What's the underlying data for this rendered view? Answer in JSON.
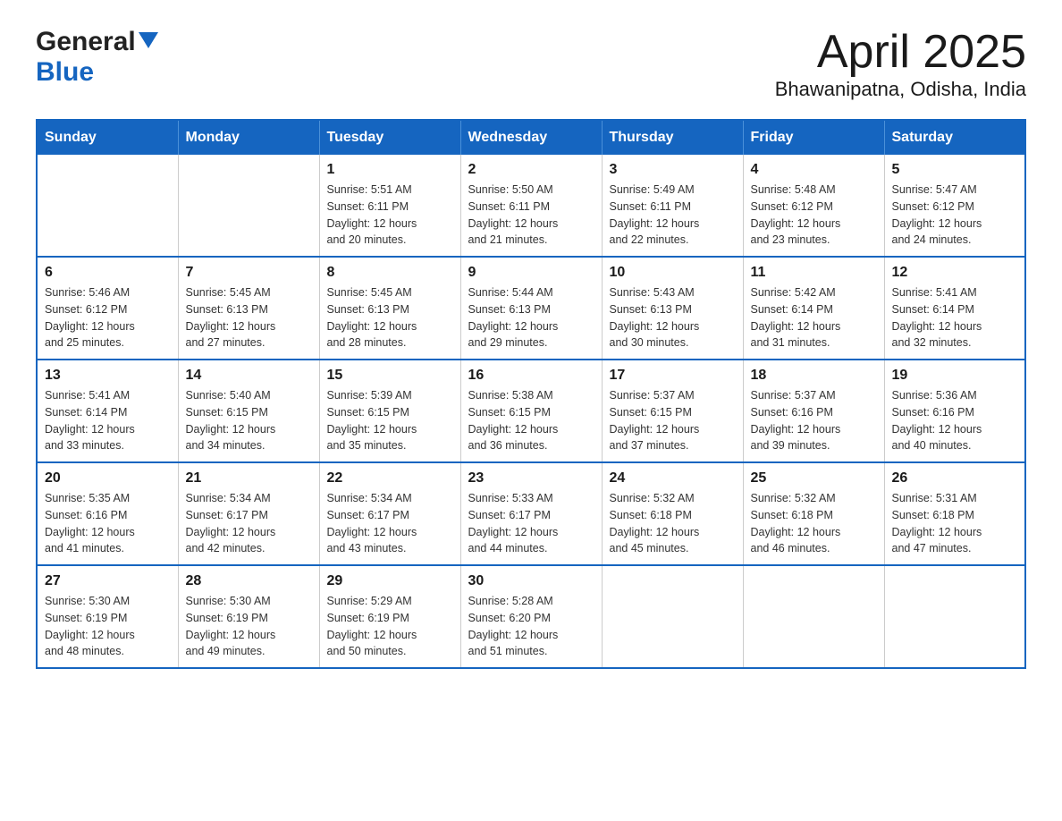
{
  "header": {
    "logo_general": "General",
    "logo_blue": "Blue",
    "month_year": "April 2025",
    "location": "Bhawanipatna, Odisha, India"
  },
  "days_of_week": [
    "Sunday",
    "Monday",
    "Tuesday",
    "Wednesday",
    "Thursday",
    "Friday",
    "Saturday"
  ],
  "weeks": [
    [
      {
        "day": "",
        "info": ""
      },
      {
        "day": "",
        "info": ""
      },
      {
        "day": "1",
        "info": "Sunrise: 5:51 AM\nSunset: 6:11 PM\nDaylight: 12 hours\nand 20 minutes."
      },
      {
        "day": "2",
        "info": "Sunrise: 5:50 AM\nSunset: 6:11 PM\nDaylight: 12 hours\nand 21 minutes."
      },
      {
        "day": "3",
        "info": "Sunrise: 5:49 AM\nSunset: 6:11 PM\nDaylight: 12 hours\nand 22 minutes."
      },
      {
        "day": "4",
        "info": "Sunrise: 5:48 AM\nSunset: 6:12 PM\nDaylight: 12 hours\nand 23 minutes."
      },
      {
        "day": "5",
        "info": "Sunrise: 5:47 AM\nSunset: 6:12 PM\nDaylight: 12 hours\nand 24 minutes."
      }
    ],
    [
      {
        "day": "6",
        "info": "Sunrise: 5:46 AM\nSunset: 6:12 PM\nDaylight: 12 hours\nand 25 minutes."
      },
      {
        "day": "7",
        "info": "Sunrise: 5:45 AM\nSunset: 6:13 PM\nDaylight: 12 hours\nand 27 minutes."
      },
      {
        "day": "8",
        "info": "Sunrise: 5:45 AM\nSunset: 6:13 PM\nDaylight: 12 hours\nand 28 minutes."
      },
      {
        "day": "9",
        "info": "Sunrise: 5:44 AM\nSunset: 6:13 PM\nDaylight: 12 hours\nand 29 minutes."
      },
      {
        "day": "10",
        "info": "Sunrise: 5:43 AM\nSunset: 6:13 PM\nDaylight: 12 hours\nand 30 minutes."
      },
      {
        "day": "11",
        "info": "Sunrise: 5:42 AM\nSunset: 6:14 PM\nDaylight: 12 hours\nand 31 minutes."
      },
      {
        "day": "12",
        "info": "Sunrise: 5:41 AM\nSunset: 6:14 PM\nDaylight: 12 hours\nand 32 minutes."
      }
    ],
    [
      {
        "day": "13",
        "info": "Sunrise: 5:41 AM\nSunset: 6:14 PM\nDaylight: 12 hours\nand 33 minutes."
      },
      {
        "day": "14",
        "info": "Sunrise: 5:40 AM\nSunset: 6:15 PM\nDaylight: 12 hours\nand 34 minutes."
      },
      {
        "day": "15",
        "info": "Sunrise: 5:39 AM\nSunset: 6:15 PM\nDaylight: 12 hours\nand 35 minutes."
      },
      {
        "day": "16",
        "info": "Sunrise: 5:38 AM\nSunset: 6:15 PM\nDaylight: 12 hours\nand 36 minutes."
      },
      {
        "day": "17",
        "info": "Sunrise: 5:37 AM\nSunset: 6:15 PM\nDaylight: 12 hours\nand 37 minutes."
      },
      {
        "day": "18",
        "info": "Sunrise: 5:37 AM\nSunset: 6:16 PM\nDaylight: 12 hours\nand 39 minutes."
      },
      {
        "day": "19",
        "info": "Sunrise: 5:36 AM\nSunset: 6:16 PM\nDaylight: 12 hours\nand 40 minutes."
      }
    ],
    [
      {
        "day": "20",
        "info": "Sunrise: 5:35 AM\nSunset: 6:16 PM\nDaylight: 12 hours\nand 41 minutes."
      },
      {
        "day": "21",
        "info": "Sunrise: 5:34 AM\nSunset: 6:17 PM\nDaylight: 12 hours\nand 42 minutes."
      },
      {
        "day": "22",
        "info": "Sunrise: 5:34 AM\nSunset: 6:17 PM\nDaylight: 12 hours\nand 43 minutes."
      },
      {
        "day": "23",
        "info": "Sunrise: 5:33 AM\nSunset: 6:17 PM\nDaylight: 12 hours\nand 44 minutes."
      },
      {
        "day": "24",
        "info": "Sunrise: 5:32 AM\nSunset: 6:18 PM\nDaylight: 12 hours\nand 45 minutes."
      },
      {
        "day": "25",
        "info": "Sunrise: 5:32 AM\nSunset: 6:18 PM\nDaylight: 12 hours\nand 46 minutes."
      },
      {
        "day": "26",
        "info": "Sunrise: 5:31 AM\nSunset: 6:18 PM\nDaylight: 12 hours\nand 47 minutes."
      }
    ],
    [
      {
        "day": "27",
        "info": "Sunrise: 5:30 AM\nSunset: 6:19 PM\nDaylight: 12 hours\nand 48 minutes."
      },
      {
        "day": "28",
        "info": "Sunrise: 5:30 AM\nSunset: 6:19 PM\nDaylight: 12 hours\nand 49 minutes."
      },
      {
        "day": "29",
        "info": "Sunrise: 5:29 AM\nSunset: 6:19 PM\nDaylight: 12 hours\nand 50 minutes."
      },
      {
        "day": "30",
        "info": "Sunrise: 5:28 AM\nSunset: 6:20 PM\nDaylight: 12 hours\nand 51 minutes."
      },
      {
        "day": "",
        "info": ""
      },
      {
        "day": "",
        "info": ""
      },
      {
        "day": "",
        "info": ""
      }
    ]
  ]
}
